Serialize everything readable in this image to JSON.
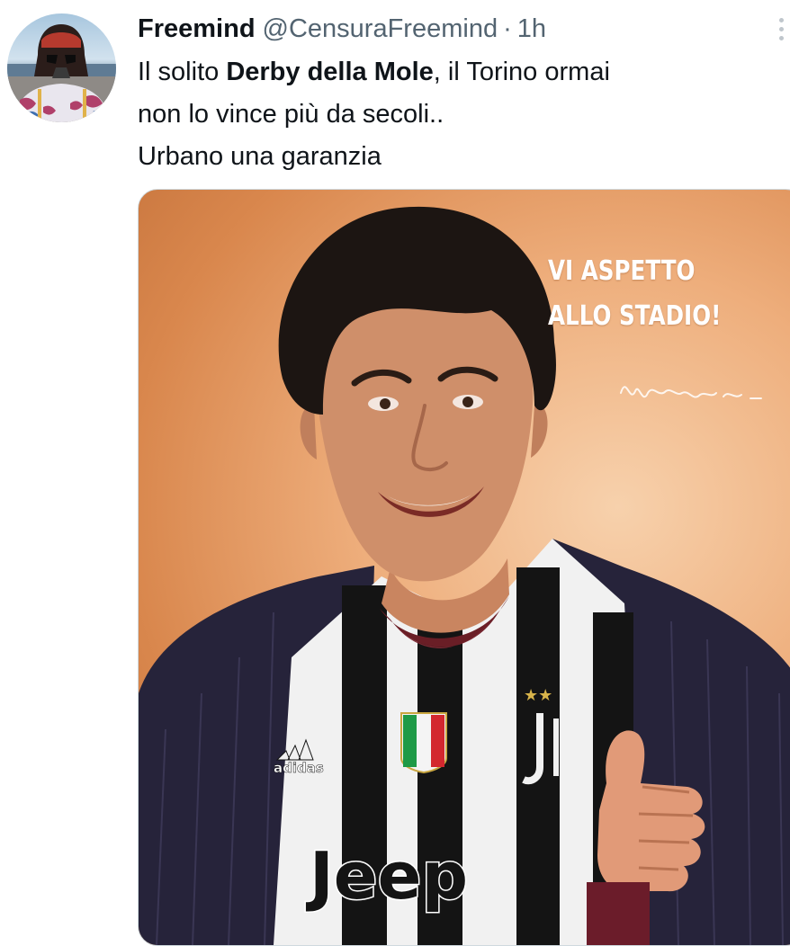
{
  "tweet": {
    "author_name": "Freemind",
    "author_handle": "@CensuraFreemind",
    "separator": "·",
    "time": "1h",
    "text_part1": "Il solito ",
    "text_bold": "Derby della Mole",
    "text_part2": ", il Torino ormai",
    "text_line2": "non lo vince più da secoli..",
    "text_line3": "Urbano una garanzia",
    "avatar_icon": "darth-vader-avatar",
    "more_icon": "more-options-icon"
  },
  "media": {
    "overlay_line1": "VI ASPETTO",
    "overlay_line2": "ALLO STADIO!",
    "jersey_text": "Jeep",
    "sponsor_text": "adidas",
    "background_color": "#eeae7c"
  },
  "colors": {
    "text_primary": "#0f1419",
    "text_secondary": "#536471",
    "jersey_black": "#141414",
    "jacket": "#26233a"
  }
}
